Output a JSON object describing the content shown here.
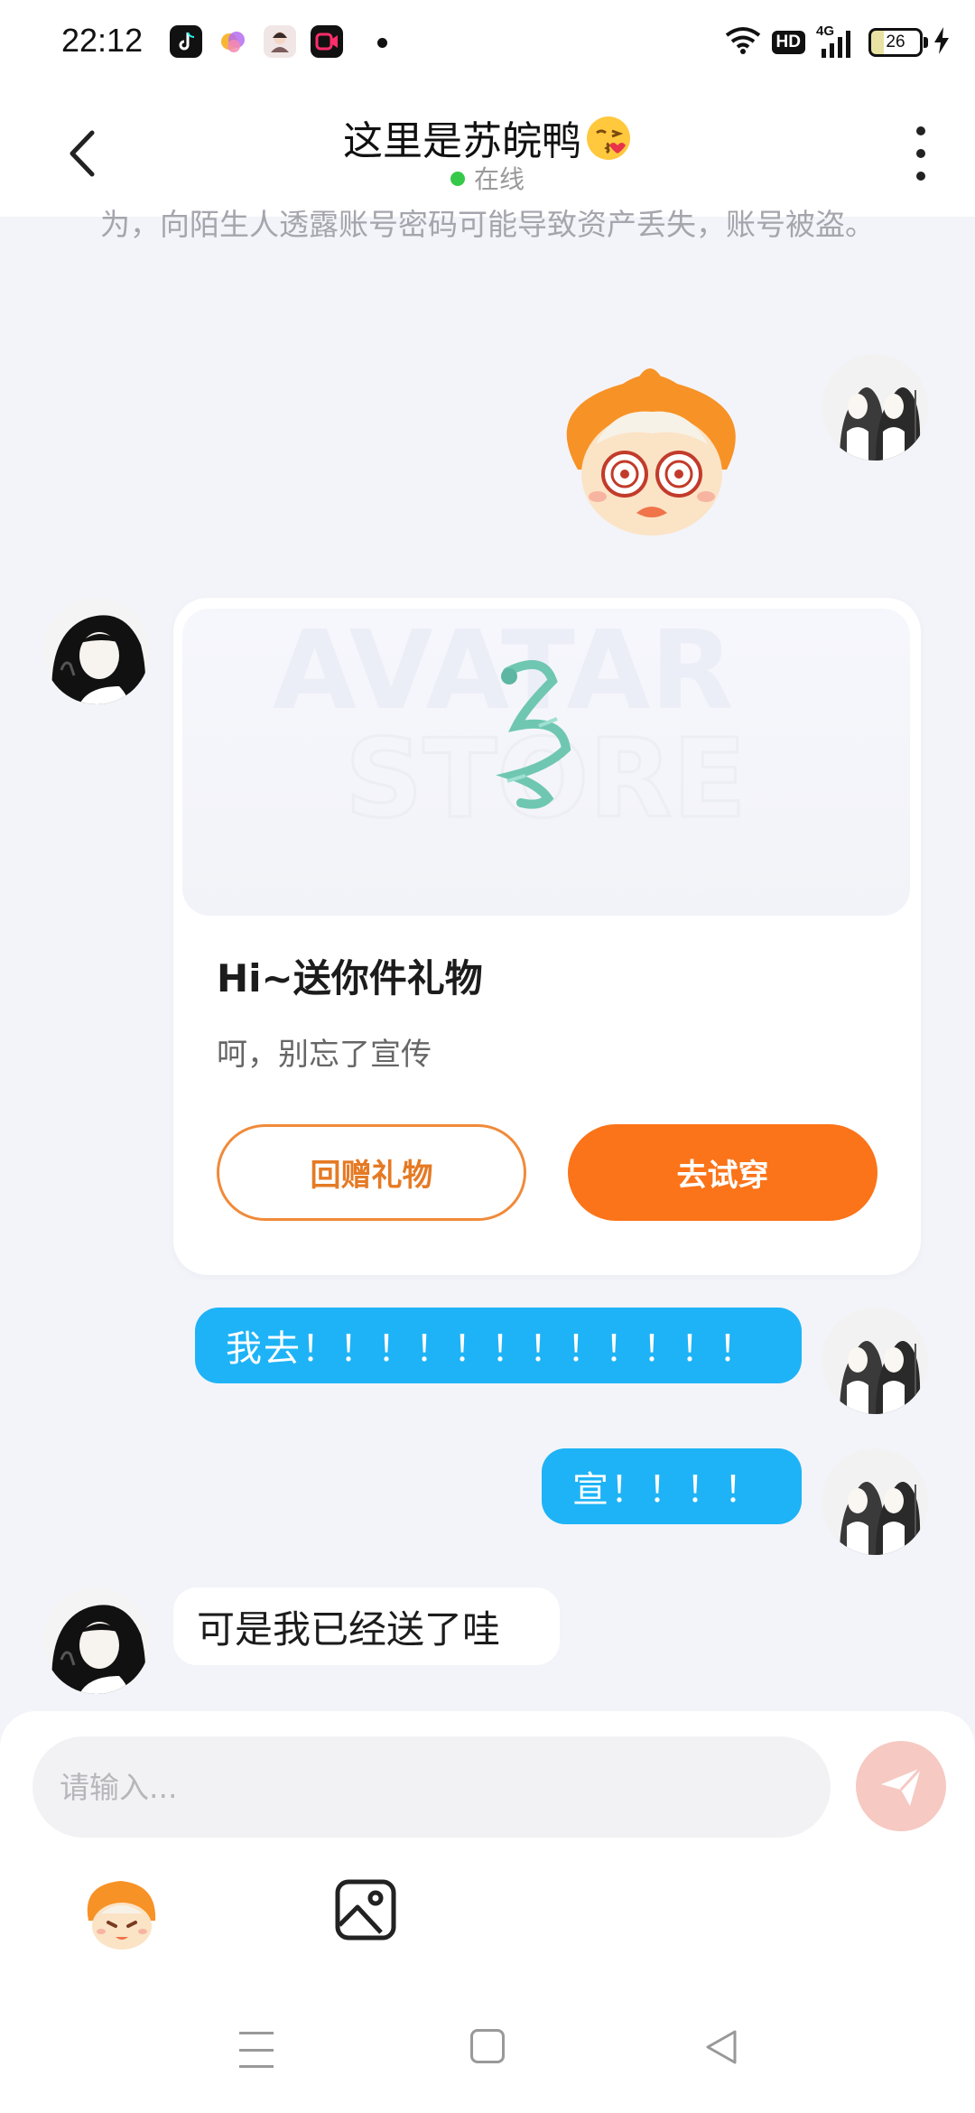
{
  "status_bar": {
    "time": "22:12",
    "hd": "HD",
    "network": "4G",
    "battery": "26",
    "icons": [
      "tiktok-icon",
      "colorful-app-icon",
      "avatar-app-icon",
      "video-app-icon",
      "wifi-icon",
      "signal-icon",
      "charging-icon"
    ]
  },
  "header": {
    "title": "这里是苏皖鸭",
    "status": "在线",
    "back_icon": "chevron-left-icon",
    "more_icon": "more-vertical-icon"
  },
  "messages": {
    "notice": "为，向陌生人透露账号密码可能导致资产丢失，账号被盗。",
    "gift_card": {
      "title": "Hi~送你件礼物",
      "subtitle": "呵，别忘了宣传",
      "return_gift_label": "回赠礼物",
      "try_on_label": "去试穿",
      "banner_text_1": "AVATAR",
      "banner_text_2": "STORE"
    },
    "msg1": "我去！！！！！！！！！！！！",
    "msg2": "宣！！！！",
    "msg3": "可是我已经送了哇"
  },
  "input": {
    "placeholder": "请输入..."
  },
  "colors": {
    "accent_orange": "#fb7419",
    "bubble_blue": "#1eb3f6",
    "online_green": "#35c94a",
    "background": "#f3f4f9"
  }
}
